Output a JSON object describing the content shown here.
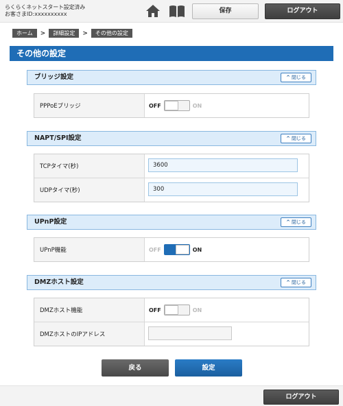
{
  "header": {
    "status_line": "らくらくネットスタート設定済み",
    "customer_id": "お客さまID:xxxxxxxxxx",
    "icons": [
      "home-icon",
      "manual-book-icon"
    ],
    "save_label": "保存",
    "logout_label": "ログアウト"
  },
  "breadcrumb": {
    "items": [
      "ホーム",
      "詳細設定",
      "その他の設定"
    ],
    "separator": ">"
  },
  "page_title": "その他の設定",
  "collapse_label": "閉じる",
  "sections": {
    "bridge": {
      "title": "ブリッジ設定",
      "rows": [
        {
          "label": "PPPoEブリッジ",
          "off": "OFF",
          "on": "ON",
          "state": "off"
        }
      ]
    },
    "napt": {
      "title": "NAPT/SPI設定",
      "rows": [
        {
          "label": "TCPタイマ(秒)",
          "value": "3600"
        },
        {
          "label": "UDPタイマ(秒)",
          "value": "300"
        }
      ]
    },
    "upnp": {
      "title": "UPnP設定",
      "rows": [
        {
          "label": "UPnP機能",
          "off": "OFF",
          "on": "ON",
          "state": "on"
        }
      ]
    },
    "dmz": {
      "title": "DMZホスト設定",
      "rows": [
        {
          "label": "DMZホスト機能",
          "off": "OFF",
          "on": "ON",
          "state": "off"
        },
        {
          "label": "DMZホストのIPアドレス",
          "value": ""
        }
      ]
    }
  },
  "actions": {
    "back_label": "戻る",
    "submit_label": "設定"
  },
  "footer": {
    "logout_label": "ログアウト"
  },
  "colors": {
    "accent": "#1f6db6",
    "section_header_bg": "#dcecfa",
    "dark_button": "#4a4a4a"
  }
}
